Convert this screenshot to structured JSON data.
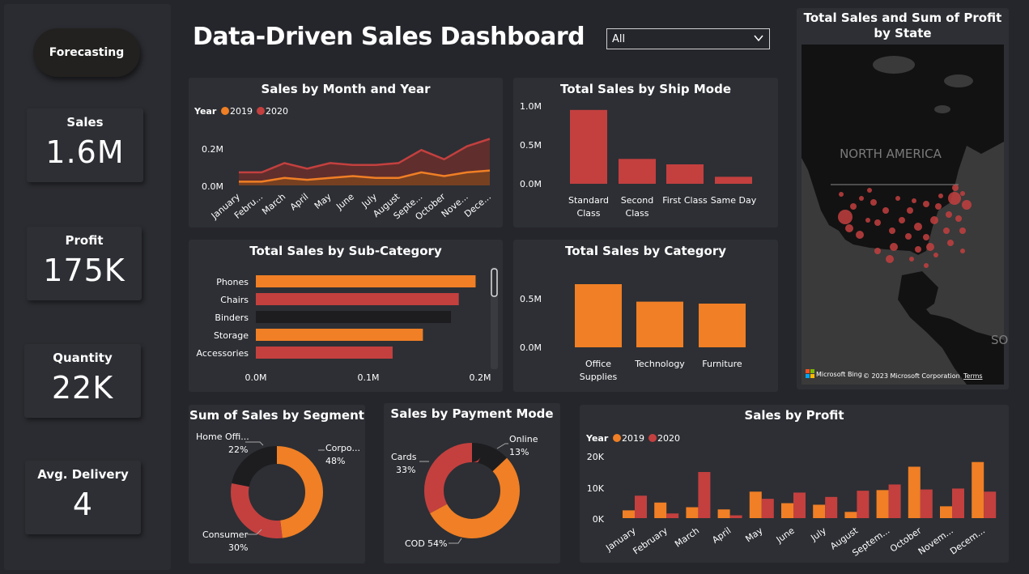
{
  "header": {
    "title": "Data-Driven Sales Dashboard",
    "filter_value": "All"
  },
  "sidebar": {
    "forecast_label": "Forecasting",
    "kpis": [
      {
        "label": "Sales",
        "value": "1.6M"
      },
      {
        "label": "Profit",
        "value": "175K"
      },
      {
        "label": "Quantity",
        "value": "22K"
      },
      {
        "label": "Avg. Delivery",
        "value": "4"
      }
    ]
  },
  "colors": {
    "orange": "#f07f25",
    "red": "#c3403f",
    "dark": "#1d1d1f"
  },
  "charts": {
    "month": {
      "title": "Sales by Month and Year"
    },
    "shipmode": {
      "title": "Total Sales by Ship Mode"
    },
    "subcat": {
      "title": "Total Sales by Sub-Category"
    },
    "category": {
      "title": "Total Sales by Category"
    },
    "segment": {
      "title": "Sum of Sales by Segment"
    },
    "payment": {
      "title": "Sales by Payment Mode"
    },
    "profit": {
      "title": "Sales by Profit"
    },
    "map": {
      "title": "Total Sales and Sum of Profit by State",
      "label_na": "NORTH AMERICA",
      "label_sa": "SOUTH AMERICA",
      "credit_bing": "Microsoft Bing",
      "credit_corp": "© 2023 Microsoft Corporation",
      "credit_terms": "Terms"
    }
  },
  "chart_data": [
    {
      "type": "area",
      "title": "Sales by Month and Year",
      "legend_title": "Year",
      "categories": [
        "January",
        "February",
        "March",
        "April",
        "May",
        "June",
        "July",
        "August",
        "September",
        "October",
        "November",
        "December"
      ],
      "tick_labels": [
        "January",
        "Febru...",
        "March",
        "April",
        "May",
        "June",
        "July",
        "August",
        "Septe...",
        "October",
        "Nove...",
        "Dece..."
      ],
      "series": [
        {
          "name": "2019",
          "values": [
            0.02,
            0.02,
            0.04,
            0.03,
            0.04,
            0.05,
            0.04,
            0.04,
            0.07,
            0.05,
            0.07,
            0.08
          ]
        },
        {
          "name": "2020",
          "values": [
            0.07,
            0.07,
            0.12,
            0.09,
            0.12,
            0.11,
            0.11,
            0.12,
            0.19,
            0.14,
            0.21,
            0.25
          ]
        }
      ],
      "yticks": [
        "0.0M",
        "0.2M"
      ],
      "ylim": [
        0,
        0.3
      ]
    },
    {
      "type": "bar",
      "title": "Total Sales by Ship Mode",
      "categories": [
        "Standard Class",
        "Second Class",
        "First Class",
        "Same Day"
      ],
      "tick_labels": [
        [
          "Standard",
          "Class"
        ],
        [
          "Second",
          "Class"
        ],
        [
          "First Class"
        ],
        [
          "Same Day"
        ]
      ],
      "values": [
        0.95,
        0.32,
        0.25,
        0.09
      ],
      "yticks": [
        "0.0M",
        "0.5M",
        "1.0M"
      ],
      "ylim": [
        0,
        1.0
      ]
    },
    {
      "type": "bar",
      "title": "Total Sales by Sub-Category",
      "orientation": "horizontal",
      "categories": [
        "Phones",
        "Chairs",
        "Binders",
        "Storage",
        "Accessories"
      ],
      "values": [
        0.196,
        0.181,
        0.174,
        0.149,
        0.122
      ],
      "xticks": [
        "0.0M",
        "0.1M",
        "0.2M"
      ],
      "xlim": [
        0,
        0.2
      ]
    },
    {
      "type": "bar",
      "title": "Total Sales by Category",
      "categories": [
        "Office Supplies",
        "Technology",
        "Furniture"
      ],
      "tick_labels": [
        [
          "Office",
          "Supplies"
        ],
        [
          "Technology"
        ],
        [
          "Furniture"
        ]
      ],
      "values": [
        0.65,
        0.47,
        0.45
      ],
      "yticks": [
        "0.0M",
        "0.5M"
      ],
      "ylim": [
        0,
        0.75
      ]
    },
    {
      "type": "pie",
      "title": "Sum of Sales by Segment",
      "slices": [
        {
          "name": "Corpo...",
          "pct": "48%",
          "value": 48
        },
        {
          "name": "Consumer",
          "pct": "30%",
          "value": 30
        },
        {
          "name": "Home Offi...",
          "pct": "22%",
          "value": 22
        }
      ]
    },
    {
      "type": "pie",
      "title": "Sales by Payment Mode",
      "slices": [
        {
          "name": "Online",
          "pct": "13%",
          "value": 13
        },
        {
          "name": "COD",
          "pct": "54%",
          "value": 54
        },
        {
          "name": "Cards",
          "pct": "33%",
          "value": 33
        }
      ]
    },
    {
      "type": "bar",
      "title": "Sales by Profit",
      "legend_title": "Year",
      "categories": [
        "January",
        "February",
        "March",
        "April",
        "May",
        "June",
        "July",
        "August",
        "September",
        "October",
        "November",
        "December"
      ],
      "tick_labels": [
        "January",
        "February",
        "March",
        "April",
        "May",
        "June",
        "July",
        "August",
        "Septem...",
        "October",
        "Novem...",
        "Decem..."
      ],
      "series": [
        {
          "name": "2019",
          "values": [
            2500,
            5000,
            3500,
            2800,
            8500,
            4800,
            4300,
            2000,
            9000,
            16500,
            3800,
            18000
          ]
        },
        {
          "name": "2020",
          "values": [
            7200,
            1500,
            14800,
            900,
            6200,
            8200,
            6800,
            8800,
            10800,
            9200,
            9500,
            8500
          ]
        }
      ],
      "yticks": [
        "0K",
        "10K",
        "20K"
      ],
      "ylim": [
        0,
        20000
      ]
    }
  ]
}
